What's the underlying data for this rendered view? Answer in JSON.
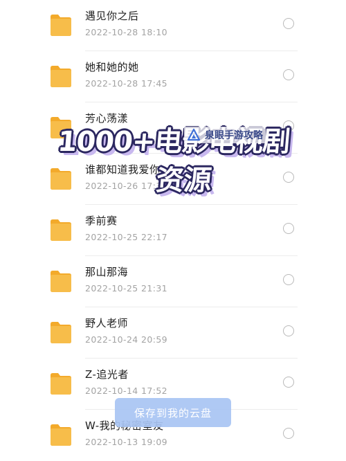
{
  "files": [
    {
      "name": "遇见你之后",
      "date": "2022-10-28 18:10"
    },
    {
      "name": "她和她的她",
      "date": "2022-10-28 17:45"
    },
    {
      "name": "芳心荡漾",
      "date": ""
    },
    {
      "name": "谁都知道我爱你",
      "date": "2022-10-26 17:3"
    },
    {
      "name": "季前赛",
      "date": "2022-10-25 22:17"
    },
    {
      "name": "那山那海",
      "date": "2022-10-25 21:31"
    },
    {
      "name": "野人老师",
      "date": "2022-10-24 20:59"
    },
    {
      "name": "Z-追光者",
      "date": "2022-10-14 17:52"
    },
    {
      "name": "W-我的秘密室友",
      "date": "2022-10-13 19:09"
    }
  ],
  "overlay": {
    "line1": "1000+电影电视剧",
    "line2": "资源",
    "watermark": "泉眼手游攻略"
  },
  "save_button": {
    "label": "保存到我的云盘"
  },
  "colors": {
    "folder": "#f7bd4a",
    "folder_tab": "#f3aa2b",
    "button": "#a9c5f4",
    "overlay_outline": "#2b2760"
  },
  "icons": {
    "folder": "folder-icon",
    "radio": "select-radio",
    "watermark": "triangle-logo-icon"
  }
}
